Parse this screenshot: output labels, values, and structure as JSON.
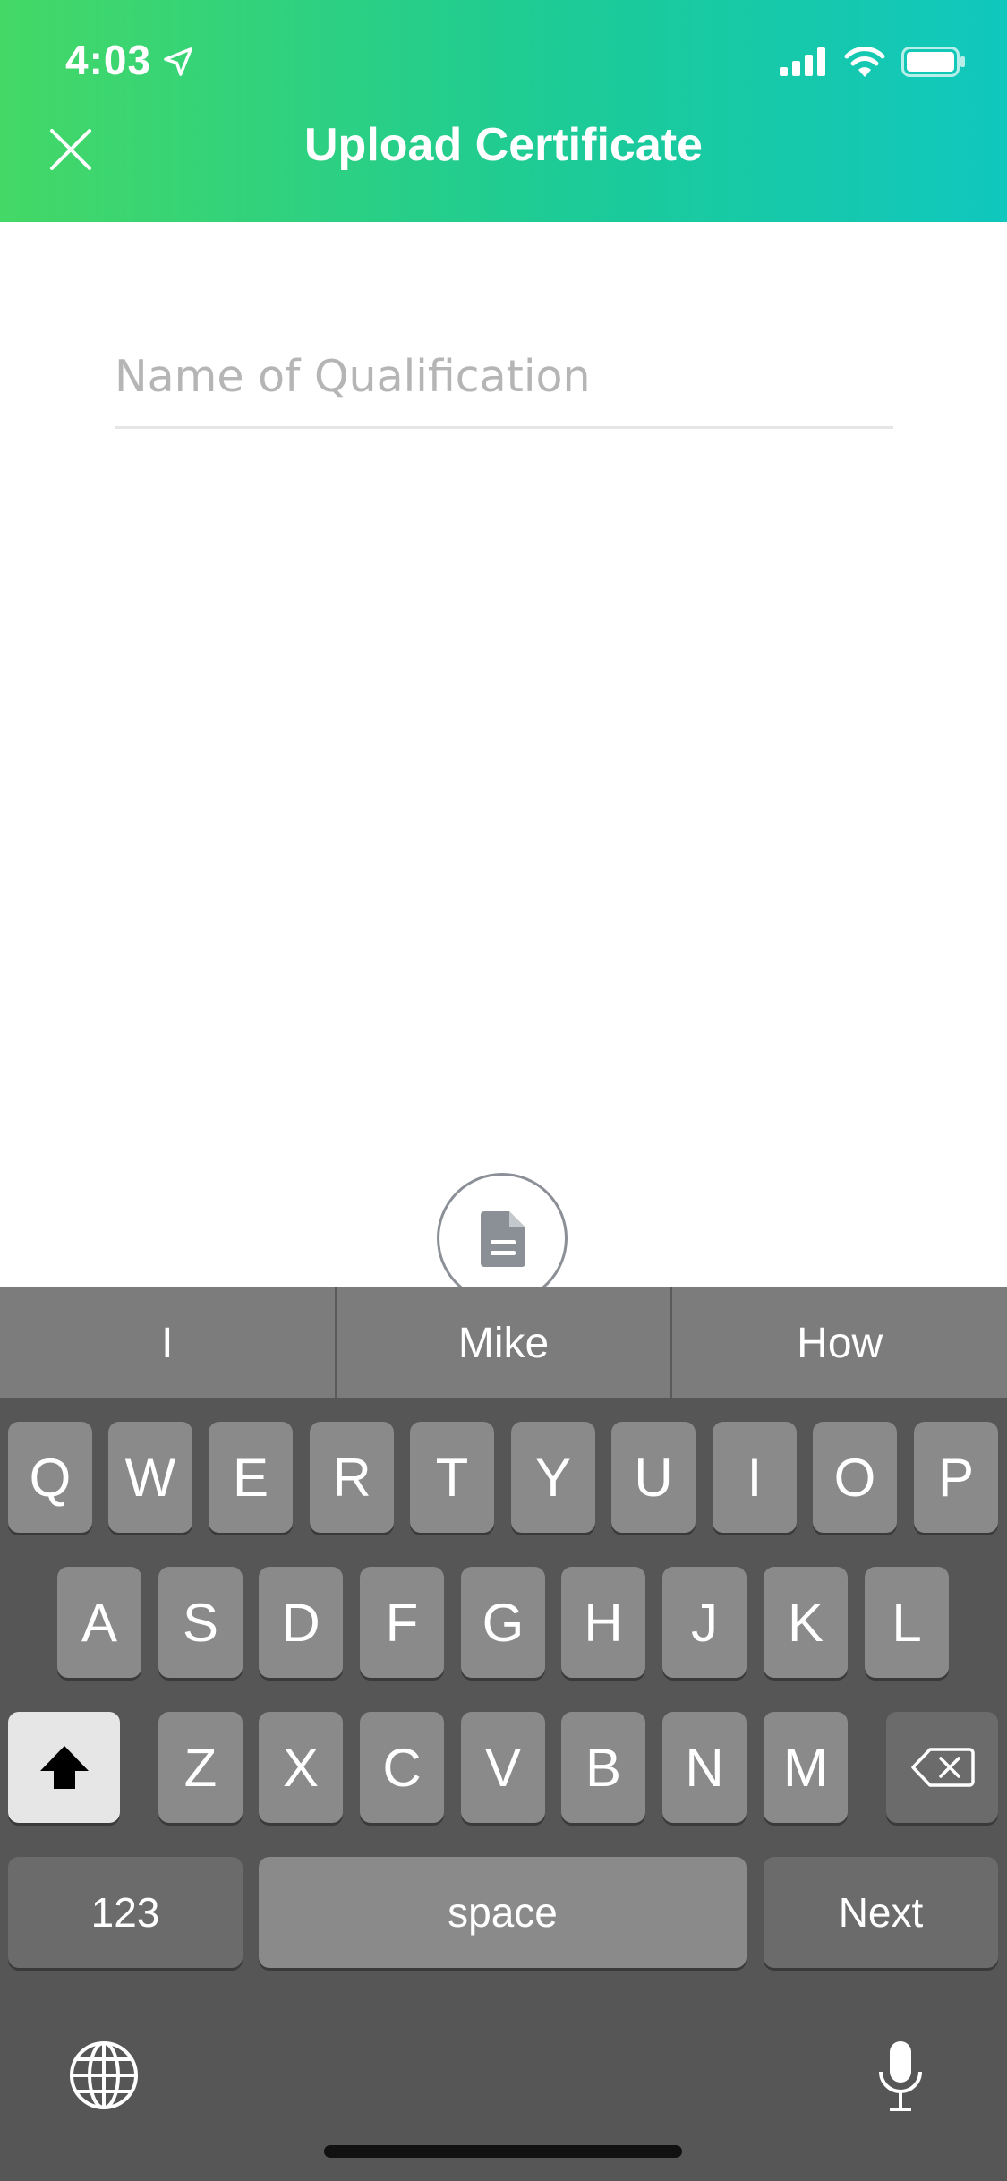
{
  "status_bar": {
    "time": "4:03"
  },
  "header": {
    "title": "Upload Certificate"
  },
  "form": {
    "qualification_placeholder": "Name of Qualification",
    "qualification_value": ""
  },
  "keyboard": {
    "predictions": [
      "I",
      "Mike",
      "How"
    ],
    "row1": [
      "Q",
      "W",
      "E",
      "R",
      "T",
      "Y",
      "U",
      "I",
      "O",
      "P"
    ],
    "row2": [
      "A",
      "S",
      "D",
      "F",
      "G",
      "H",
      "J",
      "K",
      "L"
    ],
    "row3": [
      "Z",
      "X",
      "C",
      "V",
      "B",
      "N",
      "M"
    ],
    "numbers_label": "123",
    "space_label": "space",
    "next_label": "Next"
  },
  "colors": {
    "header_start": "#44d866",
    "header_end": "#10c7be",
    "keyboard_bg": "#565656"
  }
}
